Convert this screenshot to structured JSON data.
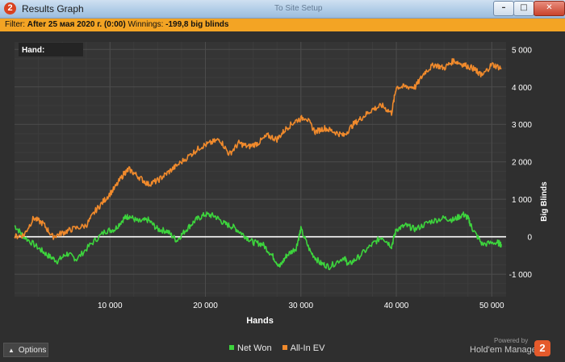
{
  "window": {
    "icon_glyph": "2",
    "title": "Results Graph",
    "background_hint": "To Site Setup",
    "controls": {
      "minimize": "–",
      "maximize": "□",
      "close": "✕"
    }
  },
  "filter": {
    "label": "Filter:",
    "value": "After 25 мая 2020 г. (0:00)",
    "winnings_label": "Winnings:",
    "winnings_value": "-199,8 big blinds"
  },
  "hand_box": {
    "label": "Hand:"
  },
  "chart_data": {
    "type": "line",
    "xlabel": "Hands",
    "ylabel": "Big Blinds",
    "xlim": [
      0,
      51500
    ],
    "ylim": [
      -1600,
      5200
    ],
    "x_ticks": [
      10000,
      20000,
      30000,
      40000,
      50000
    ],
    "x_tick_labels": [
      "10 000",
      "20 000",
      "30 000",
      "40 000",
      "50 000"
    ],
    "y_ticks": [
      5000,
      4000,
      3000,
      2000,
      1000,
      0,
      -1000
    ],
    "y_tick_labels": [
      "5 000",
      "4 000",
      "3 000",
      "2 000",
      "1 000",
      "0",
      "-1 000"
    ],
    "grid": true,
    "zero_line": true,
    "legend_position": "bottom-center",
    "series": [
      {
        "name": "Net Won",
        "color": "#3dd43d",
        "x": [
          0,
          1000,
          2500,
          3500,
          4500,
          5500,
          6500,
          8000,
          9500,
          10500,
          11500,
          12000,
          13000,
          14000,
          15000,
          16000,
          17000,
          18000,
          19000,
          20000,
          21000,
          22000,
          23000,
          24000,
          25000,
          26000,
          27000,
          27800,
          28500,
          29500,
          30000,
          31000,
          32000,
          33000,
          34500,
          35000,
          36000,
          37500,
          38500,
          39500,
          40000,
          41000,
          42000,
          43500,
          45000,
          46000,
          47000,
          47500,
          48000,
          49000,
          50500,
          51000
        ],
        "y": [
          300,
          0,
          -300,
          -500,
          -650,
          -450,
          -600,
          -200,
          150,
          200,
          500,
          550,
          400,
          450,
          200,
          150,
          -100,
          200,
          450,
          600,
          550,
          350,
          250,
          50,
          -150,
          -200,
          -500,
          -800,
          -500,
          -300,
          200,
          -400,
          -700,
          -800,
          -550,
          -750,
          -550,
          -200,
          0,
          -250,
          200,
          300,
          200,
          400,
          500,
          450,
          600,
          500,
          200,
          -200,
          -150,
          -200
        ]
      },
      {
        "name": "All-In EV",
        "color": "#f08a2c",
        "x": [
          0,
          1000,
          2000,
          3000,
          4000,
          5000,
          6000,
          7500,
          8500,
          9500,
          10500,
          11500,
          12000,
          13000,
          14000,
          15000,
          16000,
          17000,
          18500,
          19500,
          20500,
          21500,
          22500,
          23500,
          24500,
          25500,
          26500,
          27500,
          28500,
          29500,
          30500,
          31500,
          32500,
          33500,
          34500,
          35500,
          36500,
          37500,
          38500,
          39500,
          40000,
          41000,
          42000,
          43000,
          44000,
          45000,
          46000,
          47000,
          48000,
          48500,
          49000,
          50000,
          51000
        ],
        "y": [
          0,
          50,
          500,
          350,
          0,
          100,
          200,
          300,
          700,
          1000,
          1300,
          1700,
          1800,
          1600,
          1400,
          1500,
          1700,
          1900,
          2200,
          2400,
          2500,
          2600,
          2200,
          2500,
          2400,
          2500,
          2700,
          2600,
          2900,
          3100,
          3200,
          2800,
          2900,
          2800,
          2700,
          3000,
          3200,
          3400,
          3500,
          3300,
          4000,
          4000,
          4000,
          4400,
          4600,
          4500,
          4700,
          4600,
          4500,
          4400,
          4300,
          4600,
          4500
        ]
      }
    ]
  },
  "bottom": {
    "options_label": "Options",
    "powered_by": "Powered by",
    "brand": "Hold'em Manager",
    "brand_badge": "2"
  }
}
